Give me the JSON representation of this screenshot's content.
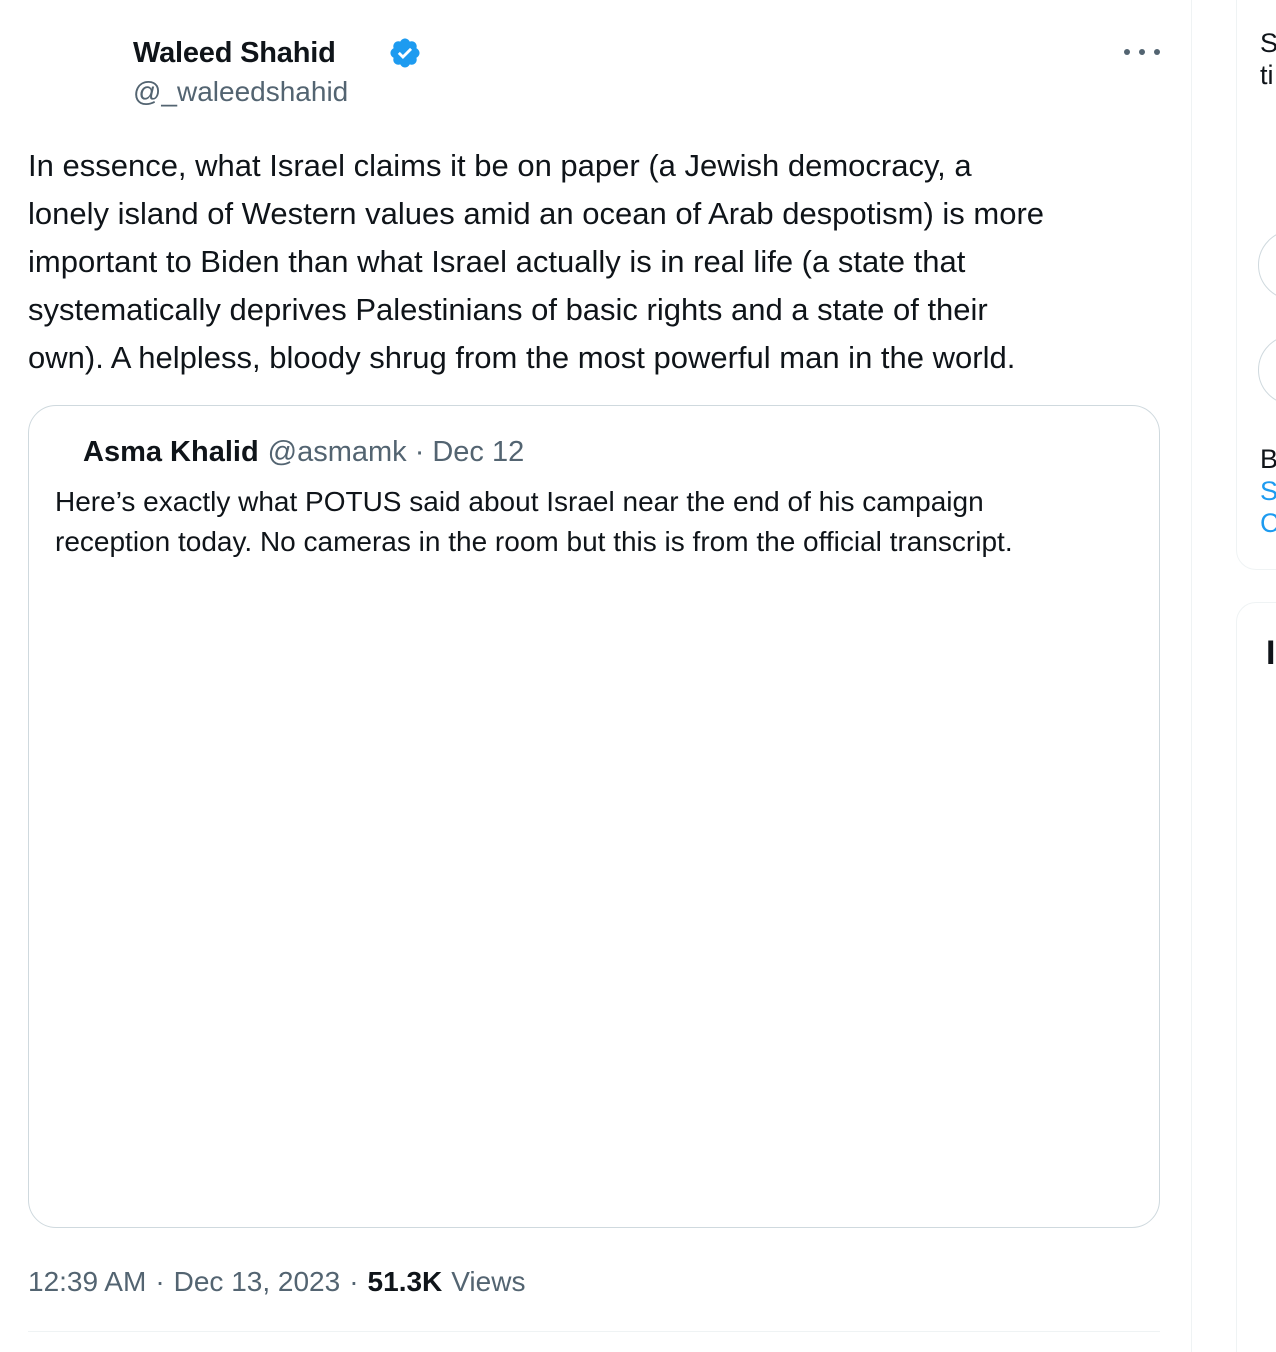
{
  "tweet": {
    "author": {
      "display_name": "Waleed Shahid",
      "username": "@_waleedshahid",
      "verified": true,
      "verified_color": "#1d9bf0"
    },
    "text": "In essence, what Israel claims it be on paper (a Jewish democracy, a\nlonely island of Western values amid an ocean of Arab despotism) is more\nimportant to Biden than what Israel actually is in real life (a state that\nsystematically deprives Palestinians of basic rights and a state of their\nown). A helpless, bloody shrug from the most powerful man in the world.",
    "quoted_tweet": {
      "display_name": "Asma Khalid",
      "username": "@asmamk",
      "separator": "·",
      "date": "Dec 12",
      "text": "Here’s exactly what POTUS said about Israel near the end of his campaign\nreception today. No cameras in the room but this is from the official transcript."
    },
    "meta": {
      "time": "12:39 AM",
      "separator": "·",
      "date": "Dec 13, 2023",
      "views_count": "51.3K",
      "views_label": "Views"
    }
  },
  "sidebar": {
    "card1_line1": "S",
    "card1_line2": "ti",
    "card1_line3": "B",
    "card1_link1": "S",
    "card1_link2": "C",
    "card2_heading": "I"
  },
  "colors": {
    "text_primary": "#0f1419",
    "text_secondary": "#536471",
    "accent": "#1d9bf0",
    "border": "#cfd9de"
  }
}
